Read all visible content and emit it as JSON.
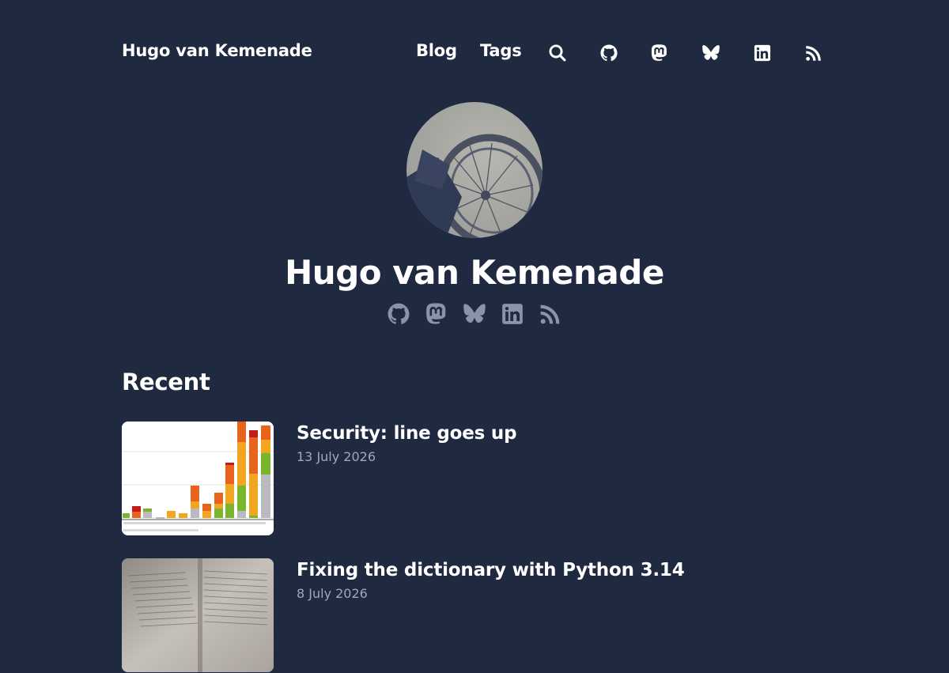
{
  "header": {
    "site_title": "Hugo van Kemenade",
    "nav": [
      {
        "label": "Blog"
      },
      {
        "label": "Tags"
      }
    ],
    "icons": [
      "search-icon",
      "github-icon",
      "mastodon-icon",
      "bluesky-icon",
      "linkedin-icon",
      "rss-icon"
    ]
  },
  "hero": {
    "name": "Hugo van Kemenade",
    "social_icons": [
      "github-icon",
      "mastodon-icon",
      "bluesky-icon",
      "linkedin-icon",
      "rss-icon"
    ]
  },
  "recent": {
    "heading": "Recent",
    "posts": [
      {
        "title": "Security: line goes up",
        "date": "13 July 2026"
      },
      {
        "title": "Fixing the dictionary with Python 3.14",
        "date": "8 July 2026"
      }
    ]
  },
  "colors": {
    "background": "#1f2940",
    "text": "#ffffff",
    "muted": "#a0a8ba",
    "social_icon": "#8b93a8"
  }
}
